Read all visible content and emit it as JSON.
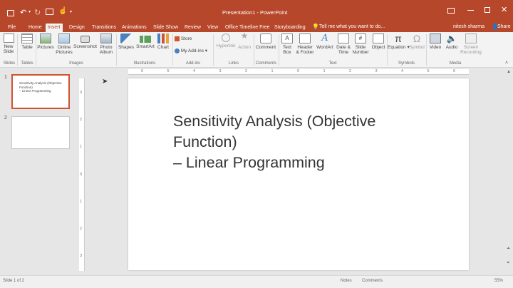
{
  "window": {
    "title": "Presentation1 - PowerPoint",
    "user": "nitesh sharma",
    "share_label": "Share",
    "tell_me": "Tell me what you want to do..."
  },
  "tabs": [
    "File",
    "Home",
    "Insert",
    "Design",
    "Transitions",
    "Animations",
    "Slide Show",
    "Review",
    "View",
    "Office Timeline Free",
    "Storyboarding"
  ],
  "active_tab": "Insert",
  "ribbon": {
    "new_slide": [
      "New",
      "Slide"
    ],
    "table": "Table",
    "pictures": "Pictures",
    "online_pictures": [
      "Online",
      "Pictures"
    ],
    "screenshot": "Screenshot",
    "photo_album": [
      "Photo",
      "Album"
    ],
    "shapes": "Shapes",
    "smartart": "SmartArt",
    "chart": "Chart",
    "store": "Store",
    "my_addins": "My Add-ins",
    "hyperlink": "Hyperlink",
    "action": "Action",
    "comment": "Comment",
    "text_box": [
      "Text",
      "Box"
    ],
    "header_footer": [
      "Header",
      "& Footer"
    ],
    "wordart": "WordArt",
    "date_time": [
      "Date &",
      "Time"
    ],
    "slide_number": [
      "Slide",
      "Number"
    ],
    "object": "Object",
    "equation": "Equation",
    "symbol": "Symbol",
    "video": "Video",
    "audio": "Audio",
    "screen_recording": [
      "Screen",
      "Recording"
    ],
    "groups": {
      "slides": "Slides",
      "tables": "Tables",
      "images": "Images",
      "illustrations": "Illustrations",
      "addins": "Add-ins",
      "links": "Links",
      "comments": "Comments",
      "text": "Text",
      "symbols": "Symbols",
      "media": "Media"
    }
  },
  "thumbnails": [
    {
      "number": "1",
      "text": [
        "Sensitivity Analysis (Objective",
        "Function)",
        "– Linear Programming"
      ]
    },
    {
      "number": "2",
      "text": []
    }
  ],
  "slide": {
    "lines": [
      "Sensitivity Analysis (Objective",
      "Function)",
      "– Linear Programming"
    ]
  },
  "ruler": {
    "h_ticks": [
      "6",
      "5",
      "4",
      "3",
      "2",
      "1",
      "0",
      "1",
      "2",
      "3",
      "4",
      "5",
      "6"
    ],
    "v_ticks": [
      "3",
      "2",
      "1",
      "0",
      "1",
      "2",
      "3"
    ]
  },
  "status": {
    "slide_info": "Slide 1 of 2",
    "notes": "Notes",
    "comments": "Comments",
    "zoom": "55%"
  },
  "colors": {
    "accent": "#b7472a",
    "selection": "#d35230"
  }
}
